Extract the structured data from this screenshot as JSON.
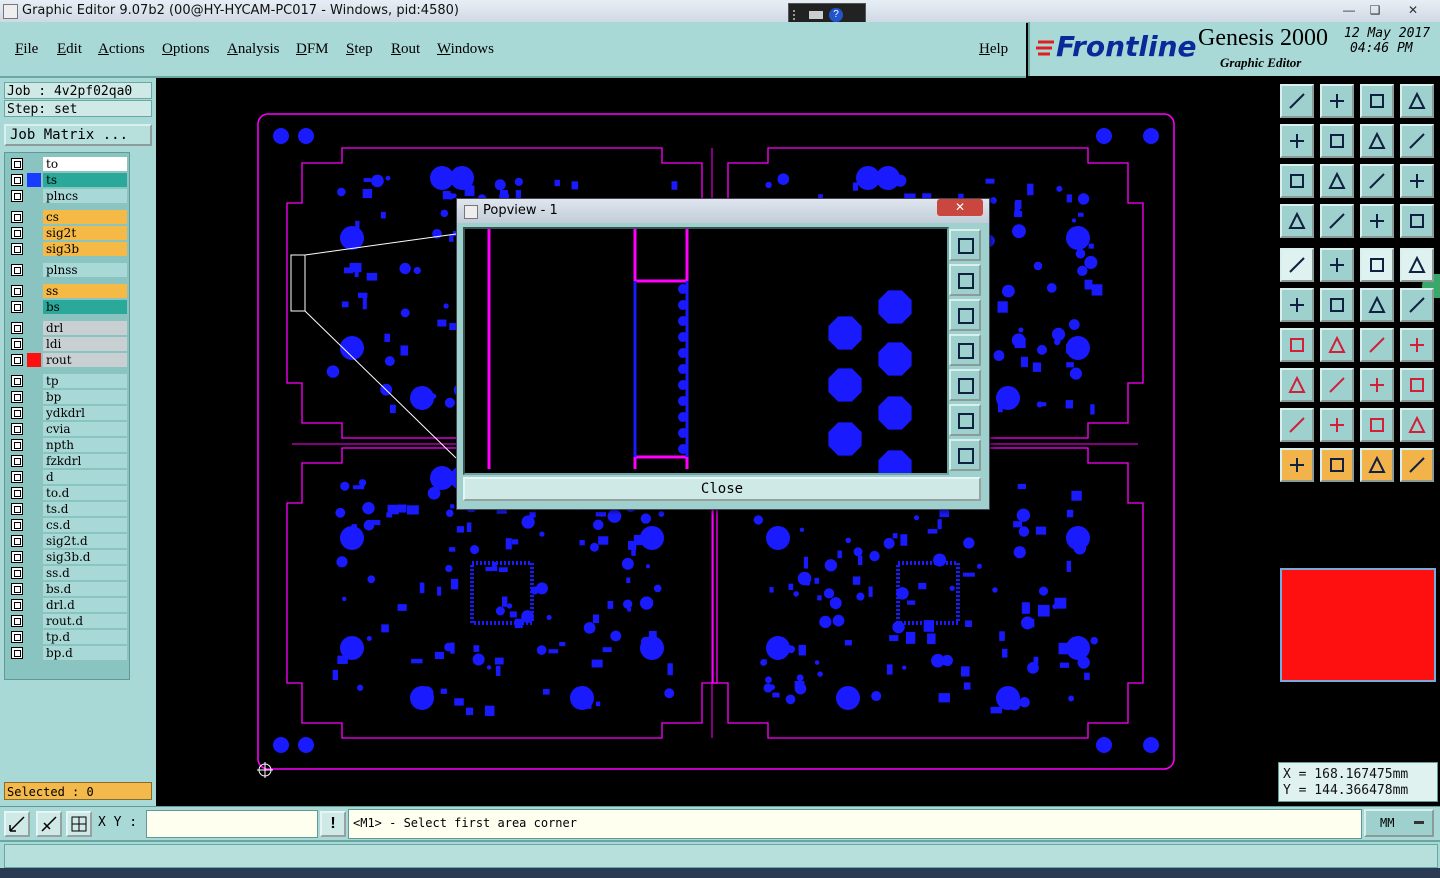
{
  "window": {
    "title": "Graphic Editor 9.07b2 (00@HY-HYCAM-PC017 - Windows, pid:4580)"
  },
  "menu": {
    "items": [
      "File",
      "Edit",
      "Actions",
      "Options",
      "Analysis",
      "DFM",
      "Step",
      "Rout",
      "Windows"
    ],
    "help": "Help"
  },
  "brand": {
    "logo": "Frontline",
    "product": "Genesis 2000",
    "subtitle": "Graphic Editor",
    "date": "12 May 2017",
    "time": "04:46 PM"
  },
  "job": {
    "job_label": "Job : 4v2pf02qa0",
    "step_label": "Step: set",
    "matrix_button": "Job Matrix ..."
  },
  "layers": [
    {
      "name": "to",
      "color": "#ffffff",
      "swatch": ""
    },
    {
      "name": "ts",
      "color": "#2aa89a",
      "swatch": "#1a3cff"
    },
    {
      "name": "plncs",
      "color": "#a9d9d6",
      "swatch": ""
    },
    {
      "name": "cs",
      "color": "#f5b946",
      "swatch": ""
    },
    {
      "name": "sig2t",
      "color": "#f5b946",
      "swatch": ""
    },
    {
      "name": "sig3b",
      "color": "#f5b946",
      "swatch": ""
    },
    {
      "name": "plnss",
      "color": "#a9d9d6",
      "swatch": ""
    },
    {
      "name": "ss",
      "color": "#f5b946",
      "swatch": ""
    },
    {
      "name": "bs",
      "color": "#2aa89a",
      "swatch": ""
    },
    {
      "name": "drl",
      "color": "#c8d0d4",
      "swatch": ""
    },
    {
      "name": "ldi",
      "color": "#c8d0d4",
      "swatch": ""
    },
    {
      "name": "rout",
      "color": "#c8d0d4",
      "swatch": "#ff1010"
    },
    {
      "name": "tp",
      "color": "#a9d9d6",
      "swatch": ""
    },
    {
      "name": "bp",
      "color": "#a9d9d6",
      "swatch": ""
    },
    {
      "name": "ydkdrl",
      "color": "#a9d9d6",
      "swatch": ""
    },
    {
      "name": "cvia",
      "color": "#a9d9d6",
      "swatch": ""
    },
    {
      "name": "npth",
      "color": "#a9d9d6",
      "swatch": ""
    },
    {
      "name": "fzkdrl",
      "color": "#a9d9d6",
      "swatch": ""
    },
    {
      "name": "d",
      "color": "#a9d9d6",
      "swatch": ""
    },
    {
      "name": "to.d",
      "color": "#a9d9d6",
      "swatch": ""
    },
    {
      "name": "ts.d",
      "color": "#a9d9d6",
      "swatch": ""
    },
    {
      "name": "cs.d",
      "color": "#a9d9d6",
      "swatch": ""
    },
    {
      "name": "sig2t.d",
      "color": "#a9d9d6",
      "swatch": ""
    },
    {
      "name": "sig3b.d",
      "color": "#a9d9d6",
      "swatch": ""
    },
    {
      "name": "ss.d",
      "color": "#a9d9d6",
      "swatch": ""
    },
    {
      "name": "bs.d",
      "color": "#a9d9d6",
      "swatch": ""
    },
    {
      "name": "drl.d",
      "color": "#a9d9d6",
      "swatch": ""
    },
    {
      "name": "rout.d",
      "color": "#a9d9d6",
      "swatch": ""
    },
    {
      "name": "tp.d",
      "color": "#a9d9d6",
      "swatch": ""
    },
    {
      "name": "bp.d",
      "color": "#a9d9d6",
      "swatch": ""
    }
  ],
  "selected": "Selected : 0",
  "popview": {
    "title": "Popview - 1",
    "close_label": "Close"
  },
  "coords": {
    "x": "X =  168.167475mm",
    "y": "Y =  144.366478mm"
  },
  "bottom": {
    "xy_label": "X Y :",
    "xy_value": "",
    "prompt": "<M1> - Select first area corner",
    "units": "MM"
  },
  "colors": {
    "panel": "#a9d9d6",
    "outline": "#ff00ff",
    "pad": "#1a1aff",
    "active_layer": "#ff1010"
  }
}
